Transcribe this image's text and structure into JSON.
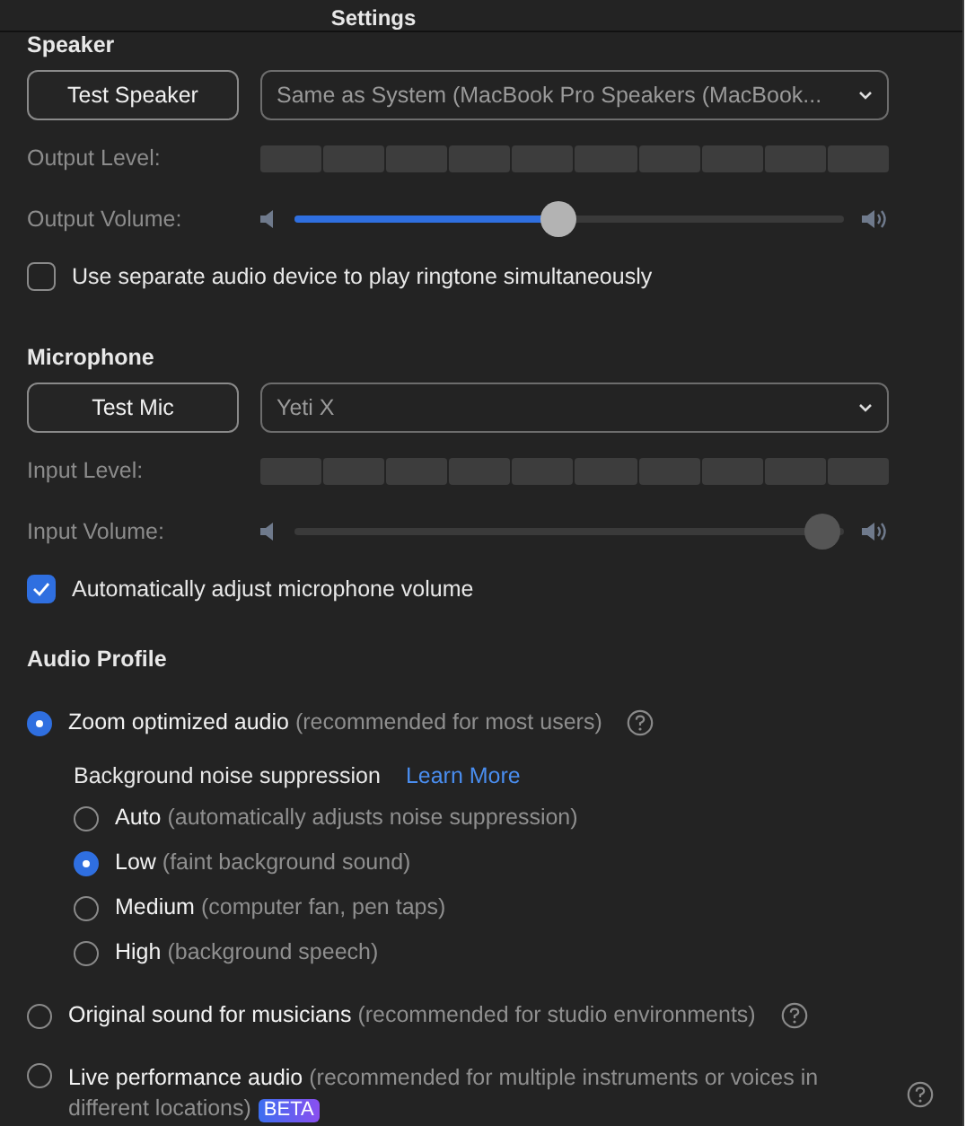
{
  "window": {
    "title": "Settings"
  },
  "speaker": {
    "heading": "Speaker",
    "test_button": "Test Speaker",
    "device": "Same as System (MacBook Pro Speakers (MacBook...",
    "level_label": "Output Level:",
    "volume_label": "Output Volume:",
    "volume": {
      "level": 0.48,
      "disabled": false
    },
    "option": {
      "label": "Use separate audio device to play ringtone simultaneously",
      "checked": false
    }
  },
  "microphone": {
    "heading": "Microphone",
    "test_button": "Test Mic",
    "device": "Yeti X",
    "level_label": "Input Level:",
    "volume_label": "Input Volume:",
    "volume": {
      "level": 0.96,
      "disabled": true
    },
    "option": {
      "label": "Automatically adjust microphone volume",
      "checked": true
    }
  },
  "audio_profile": {
    "heading": "Audio Profile",
    "options": [
      {
        "label": "Zoom optimized audio",
        "note": "(recommended for most users)",
        "selected": true,
        "help": true,
        "suppression": {
          "label": "Background noise suppression",
          "link": "Learn More",
          "options": [
            {
              "label": "Auto",
              "note": "(automatically adjusts noise suppression)",
              "selected": false
            },
            {
              "label": "Low",
              "note": "(faint background sound)",
              "selected": true
            },
            {
              "label": "Medium",
              "note": "(computer fan, pen taps)",
              "selected": false
            },
            {
              "label": "High",
              "note": "(background speech)",
              "selected": false
            }
          ]
        }
      },
      {
        "label": "Original sound for musicians",
        "note": "(recommended for studio environments)",
        "selected": false,
        "help": true
      },
      {
        "label": "Live performance audio",
        "note": "(recommended for multiple instruments or voices in different locations)",
        "selected": false,
        "help": true,
        "badge": "BETA"
      }
    ]
  }
}
